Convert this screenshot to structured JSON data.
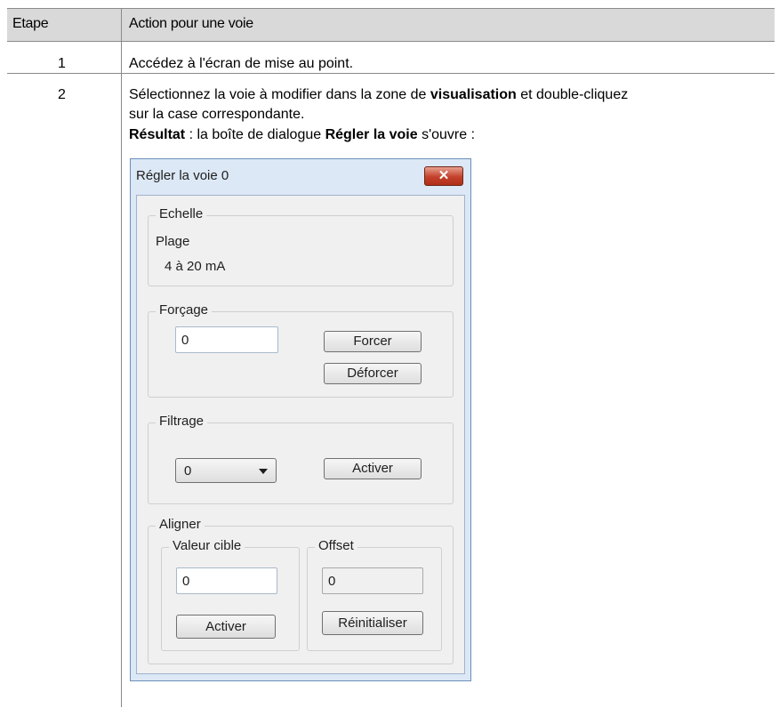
{
  "table": {
    "headers": [
      "Etape",
      "Action pour une voie"
    ],
    "rows": [
      {
        "step": "1",
        "action": "Accédez à l'écran de mise au point."
      },
      {
        "step": "2",
        "line1_pre": "Sélectionnez la voie à modifier dans la zone de ",
        "line1_bold": "visualisation",
        "line1_post": " et double-cliquez",
        "line2": "sur la case correspondante.",
        "result_label": "Résultat",
        "result_mid": " : la boîte de dialogue ",
        "result_bold": "Régler la voie",
        "result_post": " s'ouvre :"
      }
    ]
  },
  "dialog": {
    "title": "Régler la voie 0",
    "close_glyph": "✕",
    "echelle": {
      "legend": "Echelle",
      "plage_label": "Plage",
      "plage_value": "4 à 20 mA"
    },
    "forcage": {
      "legend": "Forçage",
      "value": "0",
      "force_button": "Forcer",
      "unforce_button": "Déforcer"
    },
    "filtrage": {
      "legend": "Filtrage",
      "selected": "0",
      "activate_button": "Activer"
    },
    "aligner": {
      "legend": "Aligner",
      "target": {
        "legend": "Valeur cible",
        "value": "0",
        "activate_button": "Activer"
      },
      "offset": {
        "legend": "Offset",
        "value": "0",
        "reset_button": "Réinitialiser"
      }
    }
  },
  "colors": {
    "header_bg": "#d9d9d9",
    "dialog_frame": "#dce8f5",
    "close_button": "#c3412b"
  }
}
